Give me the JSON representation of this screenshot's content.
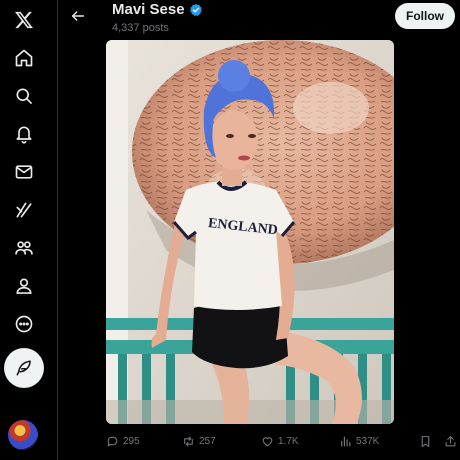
{
  "header": {
    "name": "Mavi Sese",
    "posts_count": "4,337 posts",
    "follow_label": "Follow"
  },
  "nav": {
    "items": [
      "x-logo-icon",
      "home-icon",
      "search-icon",
      "bell-icon",
      "mail-icon",
      "grok-icon",
      "communities-icon",
      "profile-icon",
      "more-icon"
    ],
    "post_icon": "feather-icon"
  },
  "media": {
    "shirt_text": "ENGLAND"
  },
  "actions": {
    "replies": "295",
    "reposts": "257",
    "likes": "1.7K",
    "views": "537K"
  },
  "colors": {
    "background": "#000000",
    "text": "#e7e9ea",
    "muted": "#71767b",
    "verified": "#1d9bf0",
    "button": "#eff3f4"
  }
}
